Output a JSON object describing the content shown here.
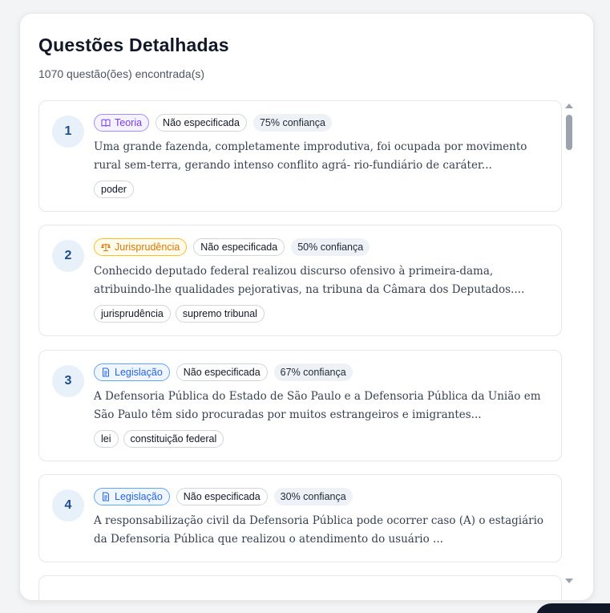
{
  "header": {
    "title": "Questões Detalhadas",
    "subtitle": "1070 questão(ões) encontrada(s)"
  },
  "questions": [
    {
      "number": "1",
      "type_label": "Teoria",
      "type_icon": "book-icon",
      "status": "Não especificada",
      "confidence": "75% confiança",
      "text": "Uma grande fazenda, completamente improdutiva, foi ocupada por movimento rural sem-terra, gerando intenso conflito agrá- rio-fundiário de caráter...",
      "tags": [
        "poder"
      ]
    },
    {
      "number": "2",
      "type_label": "Jurisprudência",
      "type_icon": "scale-icon",
      "status": "Não especificada",
      "confidence": "50% confiança",
      "text": "Conhecido deputado federal realizou discurso ofensivo à primeira-dama, atribuindo-lhe qualidades pejorativas, na tribuna da Câmara dos Deputados....",
      "tags": [
        "jurisprudência",
        "supremo tribunal"
      ]
    },
    {
      "number": "3",
      "type_label": "Legislação",
      "type_icon": "document-icon",
      "status": "Não especificada",
      "confidence": "67% confiança",
      "text": "A Defensoria Pública do Estado de São Paulo e a Defensoria Pública da União em São Paulo têm sido procuradas por muitos estrangeiros e imigrantes...",
      "tags": [
        "lei",
        "constituição federal"
      ]
    },
    {
      "number": "4",
      "type_label": "Legislação",
      "type_icon": "document-icon",
      "status": "Não especificada",
      "confidence": "30% confiança",
      "text": "A responsabilização civil da Defensoria Pública pode ocorrer caso (A) o estagiário da Defensoria Pública que realizou o atendimento do usuário ...",
      "tags": []
    }
  ],
  "colors": {
    "teoria": "#7c3aed",
    "jurisprudencia": "#d97706",
    "legislacao": "#2563eb",
    "number_text": "#1e4d8c"
  }
}
